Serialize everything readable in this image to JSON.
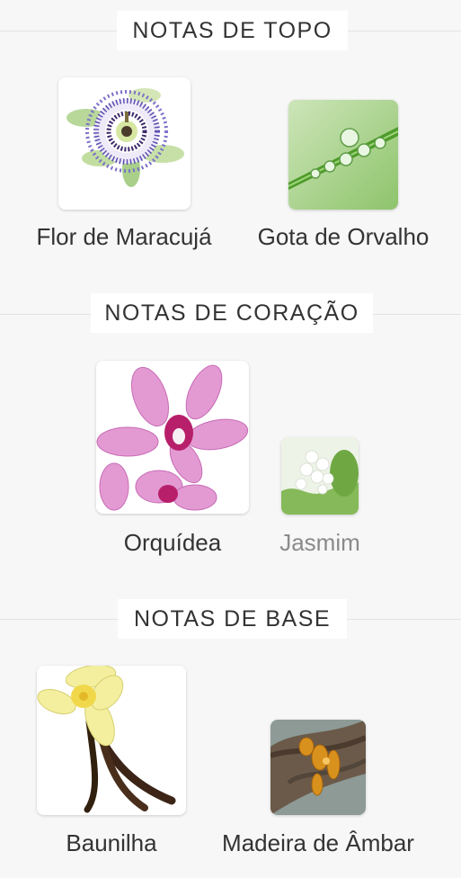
{
  "sections": [
    {
      "title": "NOTAS DE TOPO",
      "notes": [
        {
          "label": "Flor de Maracujá",
          "icon": "passion-flower-image"
        },
        {
          "label": "Gota de Orvalho",
          "icon": "dew-drop-image"
        }
      ]
    },
    {
      "title": "NOTAS DE CORAÇÃO",
      "notes": [
        {
          "label": "Orquídea",
          "icon": "orchid-image"
        },
        {
          "label": "Jasmim",
          "icon": "jasmine-image"
        }
      ]
    },
    {
      "title": "NOTAS DE BASE",
      "notes": [
        {
          "label": "Baunilha",
          "icon": "vanilla-image"
        },
        {
          "label": "Madeira de Âmbar",
          "icon": "amber-wood-image"
        }
      ]
    }
  ],
  "colors": {
    "background": "#f7f7f7",
    "text": "#333333",
    "muted_text": "#8a8a8a",
    "divider": "#e3e3e3"
  }
}
